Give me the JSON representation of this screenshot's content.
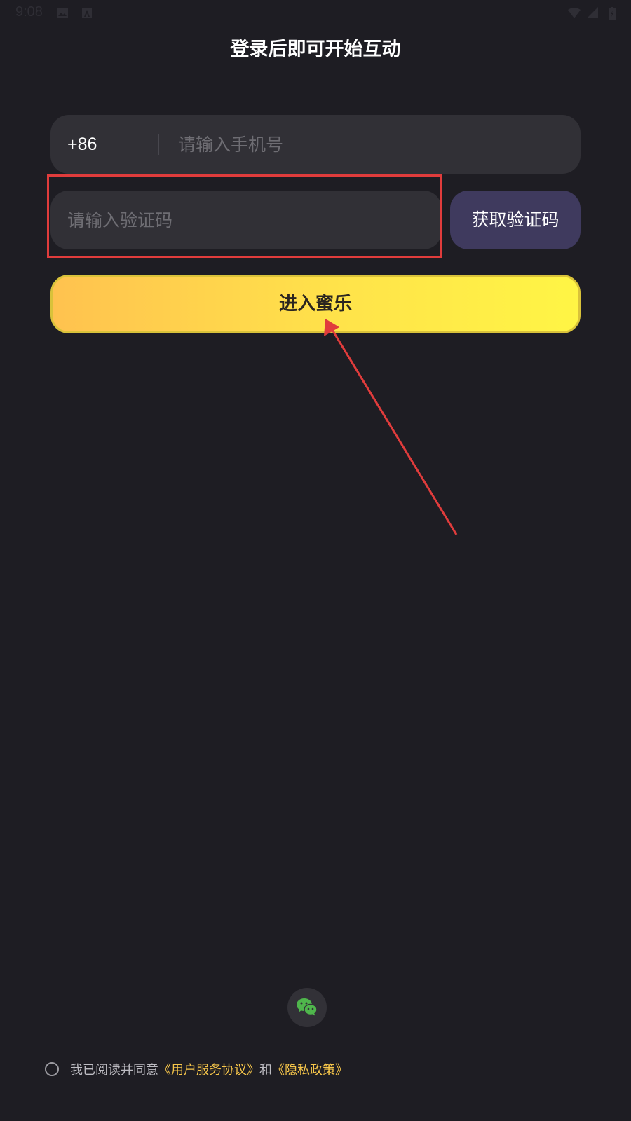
{
  "status_bar": {
    "time": "9:08"
  },
  "title": "登录后即可开始互动",
  "phone": {
    "country_code": "+86",
    "placeholder": "请输入手机号"
  },
  "code": {
    "placeholder": "请输入验证码",
    "get_code_label": "获取验证码"
  },
  "enter_button_label": "进入蜜乐",
  "agreement": {
    "prefix": "我已阅读并同意",
    "terms_link": "《用户服务协议》",
    "and": "和",
    "privacy_link": "《隐私政策》"
  },
  "colors": {
    "background": "#1e1d23",
    "field": "#313036",
    "get_code_button": "#3f3a5e",
    "enter_gradient_start": "#ffc24f",
    "enter_gradient_end": "#fff545",
    "link": "#f7c64a",
    "annotation": "#e03c3c",
    "wechat": "#4fb64c"
  },
  "icons": [
    "gallery-icon",
    "notification-a-icon",
    "wifi-icon",
    "signal-icon",
    "battery-icon",
    "wechat-icon"
  ]
}
